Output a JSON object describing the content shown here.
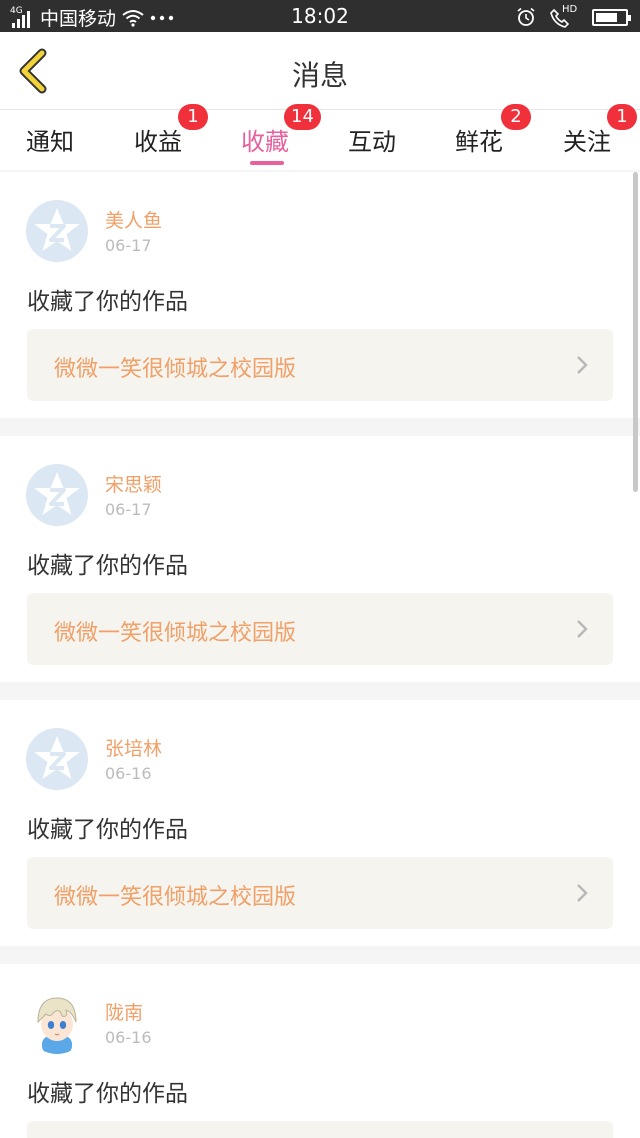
{
  "status_bar": {
    "carrier": "中国移动",
    "network": "4G",
    "time": "18:02",
    "battery_level": 0.75,
    "hd_label": "HD"
  },
  "header": {
    "title": "消息",
    "back_icon": "chevron-left-icon",
    "back_color": "#f2d43a"
  },
  "tabs": [
    {
      "label": "通知",
      "badge": ""
    },
    {
      "label": "收益",
      "badge": "1"
    },
    {
      "label": "收藏",
      "badge": "14",
      "active": true
    },
    {
      "label": "互动",
      "badge": ""
    },
    {
      "label": "鲜花",
      "badge": "2"
    },
    {
      "label": "关注",
      "badge": "1"
    }
  ],
  "colors": {
    "accent": "#e8609c",
    "badge": "#f0303a",
    "name": "#f0a068",
    "work_title": "#f0a068"
  },
  "messages": [
    {
      "name": "美人鱼",
      "date": "06-17",
      "action": "收藏了你的作品",
      "work": "微微一笑很倾城之校园版",
      "avatar": "qq-default-avatar"
    },
    {
      "name": "宋思颖",
      "date": "06-17",
      "action": "收藏了你的作品",
      "work": "微微一笑很倾城之校园版",
      "avatar": "qq-default-avatar"
    },
    {
      "name": "张培林",
      "date": "06-16",
      "action": "收藏了你的作品",
      "work": "微微一笑很倾城之校园版",
      "avatar": "qq-default-avatar"
    },
    {
      "name": "陇南",
      "date": "06-16",
      "action": "收藏了你的作品",
      "work": "",
      "avatar": "anime-boy-avatar"
    }
  ]
}
